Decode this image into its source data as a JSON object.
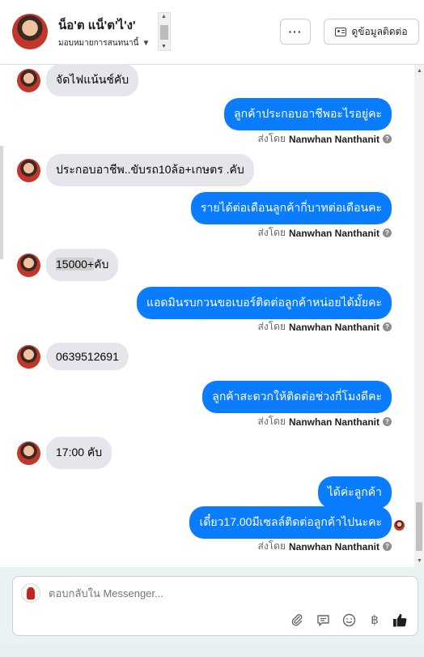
{
  "header": {
    "contact_name": "น็อ'ต แน็'ต'ไ'ง'",
    "assign_label": "มอบหมายการสนทนานี้",
    "more_label": "···",
    "view_contact_label": "ดูข้อมูลติดต่อ"
  },
  "messages": [
    {
      "dir": "in",
      "text": "จัดไฟแน้นช์คับ"
    },
    {
      "dir": "out",
      "text": "ลูกค้าประกอบอาชีพอะไรอยู่คะ"
    },
    {
      "dir": "in",
      "text": "ประกอบอาชีพ..ขับรถ10ล้อ+เกษตร .คับ"
    },
    {
      "dir": "out",
      "text": "รายได้ต่อเดือนลูกค้ากี่บาทต่อเดือนคะ"
    },
    {
      "dir": "in",
      "text_highlight": "15000+",
      "text_rest": "คับ"
    },
    {
      "dir": "out",
      "text": "แอดมินรบกวนขอเบอร์ติดต่อลูกค้าหน่อยได้มั้ยคะ"
    },
    {
      "dir": "in",
      "text": "0639512691"
    },
    {
      "dir": "out",
      "text": "ลูกค้าสะดวกให้ติดต่อช่วงกี่โมงดีคะ"
    },
    {
      "dir": "in",
      "text": "17:00 คับ"
    },
    {
      "dir": "out",
      "text": "ได้ค่ะลูกค้า"
    },
    {
      "dir": "out",
      "text": "เดี๋ยว17.00มีเซลล์ติดต่อลูกค้าไปนะคะ"
    }
  ],
  "sent_by": {
    "prefix": "ส่งโดย",
    "name": "Nanwhan Nanthanit",
    "info_icon": "question-icon"
  },
  "composer": {
    "placeholder": "ตอบกลับใน Messenger...",
    "tools": [
      "attach-icon",
      "saved-reply-icon",
      "emoji-icon",
      "baht-icon",
      "like-icon"
    ]
  },
  "colors": {
    "outgoing_bubble": "#0a7cff",
    "incoming_bubble": "#e4e6eb",
    "secondary_text": "#65676b"
  }
}
